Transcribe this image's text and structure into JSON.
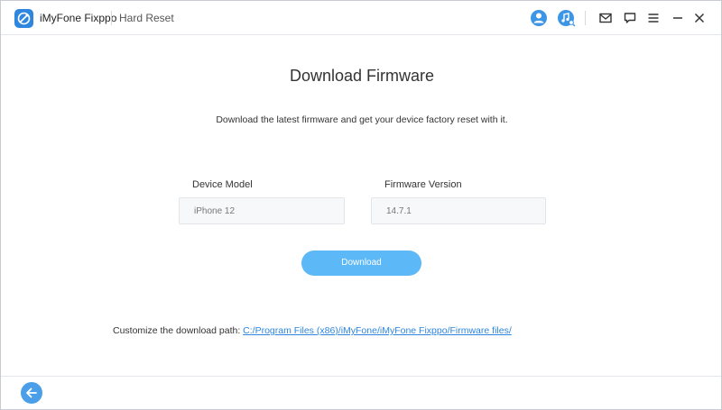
{
  "titlebar": {
    "app_name": "iMyFone Fixppo",
    "mode": "Hard Reset",
    "icons": [
      "app-logo",
      "account-icon",
      "music-search-icon",
      "mail-icon",
      "feedback-icon",
      "menu-icon",
      "close-icon"
    ]
  },
  "main": {
    "title": "Download Firmware",
    "subtitle": "Download the latest firmware and get your device factory reset with it.",
    "device_model_label": "Device Model",
    "device_model_value": "iPhone 12",
    "firmware_version_label": "Firmware Version",
    "firmware_version_value": "14.7.1",
    "download_button": "Download",
    "path_prefix": "Customize the download path: ",
    "path_link": "C:/Program Files (x86)/iMyFone/iMyFone Fixppo/Firmware files/"
  },
  "footer": {
    "back_icon": "back-arrow-icon"
  },
  "colors": {
    "accent": "#5cb8f6",
    "link": "#2e86de",
    "brand": "#2e86de"
  }
}
